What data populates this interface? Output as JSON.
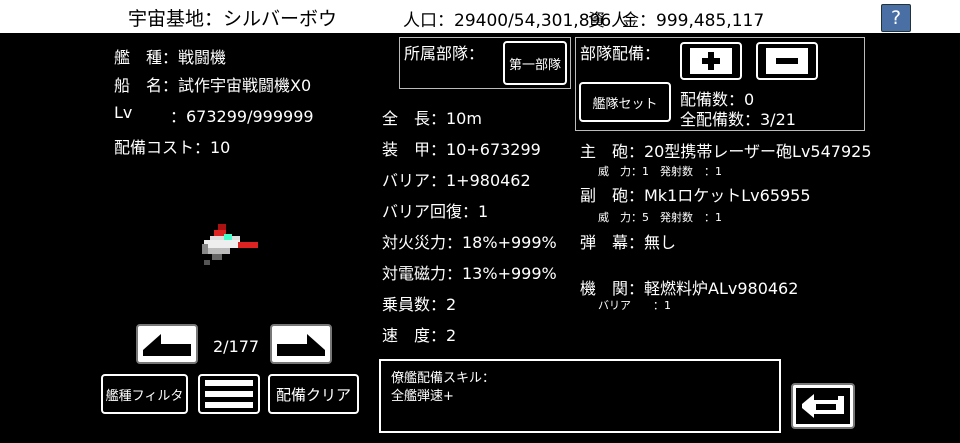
{
  "header": {
    "base_label": "宇宙基地：シルバーボウ",
    "population": "人口：29400/54,301,896人",
    "funds": "資　金：999,485,117",
    "help_label": "?"
  },
  "ship": {
    "type": "艦　種：戦闘機",
    "name": "船　名：試作宇宙戦闘機X0",
    "level_label": "Lv",
    "level_value": "：673299/999999",
    "cost": "配備コスト：10"
  },
  "nav": {
    "counter": "2/177"
  },
  "buttons": {
    "filter": "艦種フィルタ",
    "clear": "配備クリア",
    "unit": "第一部隊",
    "fleet_set": "艦隊セット"
  },
  "unit": {
    "label": "所属部隊："
  },
  "deploy": {
    "label": "部隊配備：",
    "count": "配備数：0",
    "total": "全配備数：3/21"
  },
  "stats": [
    "全　長：10m",
    "装　甲：10+673299",
    "バリア：1+980462",
    "バリア回復：1",
    "対火災力：18%+999%",
    "対電磁力：13%+999%",
    "乗員数：2",
    "速　度：2"
  ],
  "weapons": {
    "main": "主　砲：20型携帯レーザー砲Lv547925",
    "main_detail": "威　力：1　発射数　：1",
    "sub": "副　砲：Mk1ロケットLv65955",
    "sub_detail": "威　力：5　発射数　：1",
    "barrage": "弾　幕：無し",
    "engine": "機　関：軽燃料炉ALv980462",
    "engine_detail": "バリア　　：1"
  },
  "skill": {
    "title": "僚艦配備スキル：",
    "value": "全艦弾速+"
  },
  "colors": {
    "help_bg": "#4a6fa5",
    "ship_red": "#d22",
    "ship_cyan": "#4fc"
  }
}
